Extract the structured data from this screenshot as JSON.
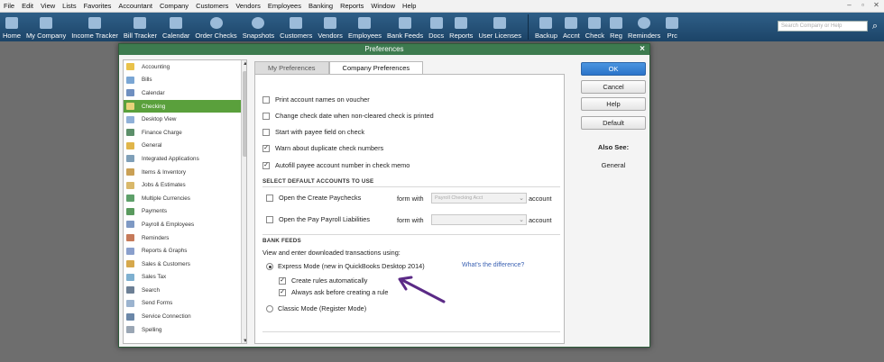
{
  "menu": [
    "File",
    "Edit",
    "View",
    "Lists",
    "Favorites",
    "Accountant",
    "Company",
    "Customers",
    "Vendors",
    "Employees",
    "Banking",
    "Reports",
    "Window",
    "Help"
  ],
  "toolbar": {
    "items": [
      "Home",
      "My Company",
      "Income Tracker",
      "Bill Tracker",
      "Calendar",
      "Order Checks",
      "Snapshots",
      "Customers",
      "Vendors",
      "Employees",
      "Bank Feeds",
      "Docs",
      "Reports",
      "User Licenses",
      "Backup",
      "Accnt",
      "Check",
      "Reg",
      "Reminders",
      "Prc"
    ],
    "search_placeholder": "Search Company or Help"
  },
  "dialog": {
    "title": "Preferences",
    "close": "×",
    "categories": [
      "Accounting",
      "Bills",
      "Calendar",
      "Checking",
      "Desktop View",
      "Finance Charge",
      "General",
      "Integrated Applications",
      "Items & Inventory",
      "Jobs & Estimates",
      "Multiple Currencies",
      "Payments",
      "Payroll & Employees",
      "Reminders",
      "Reports & Graphs",
      "Sales & Customers",
      "Sales Tax",
      "Search",
      "Send Forms",
      "Service Connection",
      "Spelling"
    ],
    "selected_category": "Checking",
    "tabs": [
      "My Preferences",
      "Company Preferences"
    ],
    "active_tab": "Company Preferences",
    "options": [
      {
        "label": "Print account names on voucher",
        "checked": false
      },
      {
        "label": "Change check date when non-cleared check is printed",
        "checked": false
      },
      {
        "label": "Start with payee field on check",
        "checked": false
      },
      {
        "label": "Warn about duplicate check numbers",
        "checked": true
      },
      {
        "label": "Autofill payee account number in check memo",
        "checked": true
      }
    ],
    "default_accounts": {
      "header": "SELECT DEFAULT ACCOUNTS TO USE",
      "rows": [
        {
          "label": "Open the Create Paychecks",
          "form_with": "form with",
          "value": "Payroll Checking Acct",
          "account": "account"
        },
        {
          "label": "Open the Pay Payroll Liabilities",
          "form_with": "form with",
          "value": "",
          "account": "account"
        }
      ]
    },
    "bank_feeds": {
      "header": "BANK FEEDS",
      "intro": "View and enter downloaded transactions using:",
      "express_mode": "Express Mode (new in QuickBooks Desktop 2014)",
      "whats_diff": "What's the difference?",
      "create_rules": "Create rules automatically",
      "always_ask": "Always ask before creating a rule",
      "classic_mode": "Classic Mode (Register Mode)",
      "mode": "express"
    },
    "buttons": {
      "ok": "OK",
      "cancel": "Cancel",
      "help": "Help",
      "default": "Default"
    },
    "also_see": {
      "title": "Also See:",
      "link": "General"
    }
  },
  "colors": {
    "toolbar": "#1c4468",
    "dialog_title": "#3d7b4f",
    "selected": "#5aa03c",
    "ok": "#2b74c9",
    "arrow": "#5b2a86"
  }
}
